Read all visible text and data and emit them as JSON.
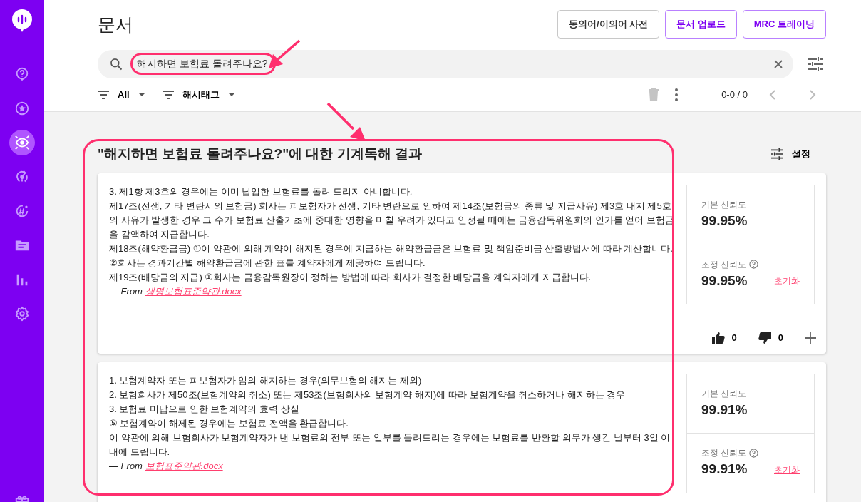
{
  "sidebar": {
    "items": [
      {
        "selected": false
      },
      {
        "selected": false
      },
      {
        "selected": true
      },
      {
        "selected": false
      },
      {
        "selected": false
      },
      {
        "selected": false
      },
      {
        "selected": false
      },
      {
        "selected": false
      },
      {
        "selected": false
      }
    ]
  },
  "page_title": "문서",
  "header_buttons": [
    {
      "label": "동의어/이의어 사전",
      "kind": "neutral"
    },
    {
      "label": "문서 업로드",
      "kind": "accent"
    },
    {
      "label": "MRC 트레이닝",
      "kind": "accent"
    }
  ],
  "search": {
    "value": "해지하면 보험료 돌려주나요?",
    "highlighted": true
  },
  "filters": [
    {
      "label": "All"
    },
    {
      "label": "해시태그"
    }
  ],
  "pagination": {
    "range": "0-0 / 0"
  },
  "results_title": "\"해지하면 보험료 돌려주나요?\"에 대한 기계독해 결과",
  "settings_label": "설정",
  "results": [
    {
      "lines": [
        "3. 제1항 제3호의 경우에는 이미 납입한 보험료를 돌려 드리지 아니합니다.",
        "제17조(전쟁, 기타 변란시의 보험금) 회사는 피보험자가 전쟁, 기타 변란으로 인하여 제14조(보험금의 종류 및 지급사유) 제3호 내지 제5호의 사유가 발생한 경우 그 수가 보험료 산출기초에 중대한 영향을 미칠 우려가 있다고 인정될 때에는 금융감독위원회의 인가를 얻어 보험금을 감액하여 지급합니다.",
        "제18조(해약환급금) ①이 약관에 의해 계약이 해지된 경우에 지급하는 해약환급금은 보험료 및 책임준비금 산출방법서에 따라 계산합니다.",
        "②회사는 경과기간별 해약환급금에 관한 표를 계약자에게 제공하여 드립니다.",
        "제19조(배당금의 지급) ①회사는 금융감독원장이 정하는 방법에 따라 회사가 결정한 배당금을 계약자에게 지급합니다."
      ],
      "source_prefix": "— From",
      "source_file": "생명보험표준약관.docx",
      "base_label": "기본 신뢰도",
      "base_value": "99.95%",
      "adjusted_label": "조정 신뢰도",
      "adjusted_value": "99.95%",
      "reset_label": "초기화",
      "likes": "0",
      "dislikes": "0"
    },
    {
      "lines": [
        "1. 보험계약자 또는 피보험자가 임의 해지하는 경우(의무보험의 해지는 제외)",
        "2. 보험회사가 제50조(보험계약의 취소) 또는 제53조(보험회사의 보험계약 해지)에 따라 보험계약을 취소하거나 해지하는 경우",
        "3. 보험료 미납으로 인한 보험계약의 효력 상실",
        "⑤ 보험계약이 해제된 경우에는 보험료 전액을 환급합니다.",
        "이 약관에 의해 보험회사가 보험계약자가 낸 보험료의 전부 또는 일부를 돌려드리는 경우에는 보험료를 반환할 의무가 생긴 날부터 3일 이내에 드립니다."
      ],
      "source_prefix": "— From",
      "source_file": "보험표준약관.docx",
      "base_label": "기본 신뢰도",
      "base_value": "99.91%",
      "adjusted_label": "조정 신뢰도",
      "adjusted_value": "99.91%",
      "reset_label": "초기화"
    }
  ],
  "results_highlighted": true
}
